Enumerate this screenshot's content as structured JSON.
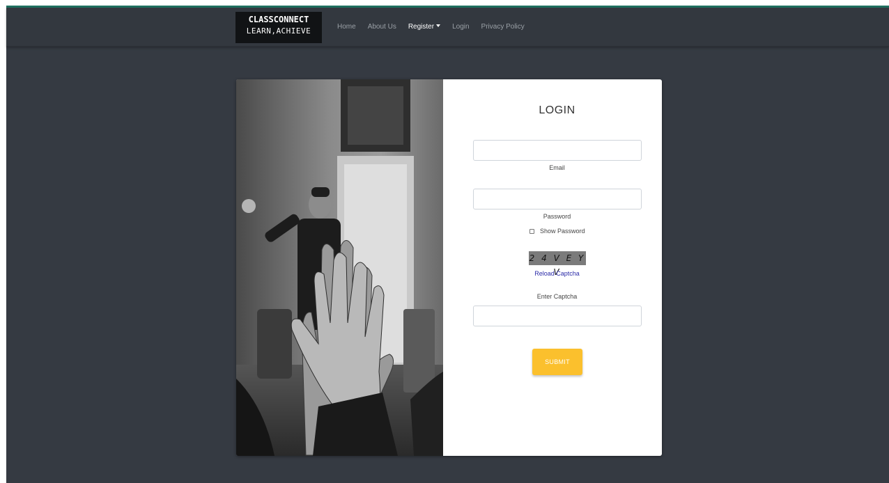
{
  "brand": {
    "name": "CLASSCONNECT",
    "tagline": "LEARN,ACHIEVE"
  },
  "nav": {
    "items": [
      {
        "label": "Home"
      },
      {
        "label": "About Us"
      },
      {
        "label": "Register",
        "has_dropdown": true
      },
      {
        "label": "Login"
      },
      {
        "label": "Privacy Policy"
      }
    ]
  },
  "login": {
    "title": "LOGIN",
    "email": {
      "label": "Email",
      "value": ""
    },
    "password": {
      "label": "Password",
      "value": ""
    },
    "show_password": {
      "label": "Show Password",
      "checked": false
    },
    "captcha": {
      "text": "2 4 V E Y V",
      "reload_label": "Reload Captcha"
    },
    "captcha_input": {
      "label": "Enter Captcha",
      "value": ""
    },
    "submit_label": "SUBMIT"
  },
  "colors": {
    "background": "#353a42",
    "navbar": "#33383f",
    "accent_top": "#1f6f5f",
    "submit_button": "#fbc02d",
    "link": "#2b2ba8"
  }
}
